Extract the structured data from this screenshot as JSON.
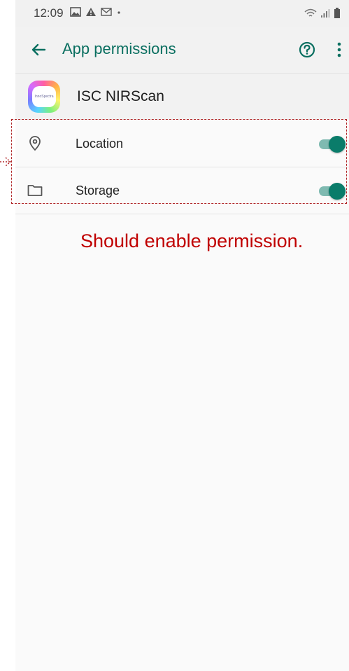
{
  "status_bar": {
    "time": "12:09",
    "left_icons": [
      "image-icon",
      "warning-icon",
      "gmail-icon",
      "dot-icon"
    ],
    "right_icons": [
      "wifi-icon",
      "signal-icon",
      "battery-icon"
    ]
  },
  "app_bar": {
    "title": "App permissions",
    "icons": [
      "back-arrow-icon",
      "help-icon",
      "more-vert-icon"
    ]
  },
  "app_header": {
    "name": "ISC NIRScan",
    "logo_text": "InnoSpectra"
  },
  "permissions": [
    {
      "label": "Location",
      "icon": "location-pin-icon",
      "enabled": true
    },
    {
      "label": "Storage",
      "icon": "folder-icon",
      "enabled": true
    }
  ],
  "annotation": {
    "text": "Should enable permission."
  },
  "colors": {
    "accent": "#0a6f60",
    "toggle_thumb": "#0a7c6a",
    "toggle_track": "#7fbab1",
    "annotation": "#c00000"
  }
}
